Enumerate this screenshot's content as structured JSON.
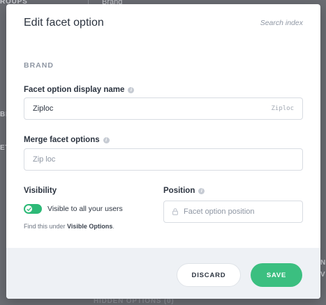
{
  "background": {
    "groups_label": "ROUPS",
    "brand_label": "Brand",
    "left_fragment_1": "BR",
    "left_fragment_2": "ET",
    "hidden_options_label": "HIDDEN OPTIONS (0)",
    "right_fragment_1": "n",
    "right_fragment_2": "v"
  },
  "modal": {
    "title": "Edit facet option",
    "search_index_link": "Search index",
    "section_label": "BRAND",
    "display_name": {
      "label": "Facet option display name",
      "value": "Ziploc",
      "hint": "Ziploc"
    },
    "merge": {
      "label": "Merge facet options",
      "value": "Zip loc"
    },
    "visibility": {
      "label": "Visibility",
      "toggle_text": "Visible to all your users",
      "toggle_on": true,
      "helper_prefix": "Find this under ",
      "helper_link": "Visible Options",
      "helper_suffix": "."
    },
    "position": {
      "label": "Position",
      "placeholder": "Facet option position"
    },
    "footer": {
      "discard_label": "DISCARD",
      "save_label": "SAVE"
    }
  },
  "colors": {
    "accent_green": "#3bbf80",
    "toggle_green": "#2db977",
    "overlay": "#6b6d73",
    "footer_bg": "#eef1f5"
  },
  "icons": {
    "info": "info-icon",
    "lock": "lock-icon",
    "check": "check-icon"
  }
}
